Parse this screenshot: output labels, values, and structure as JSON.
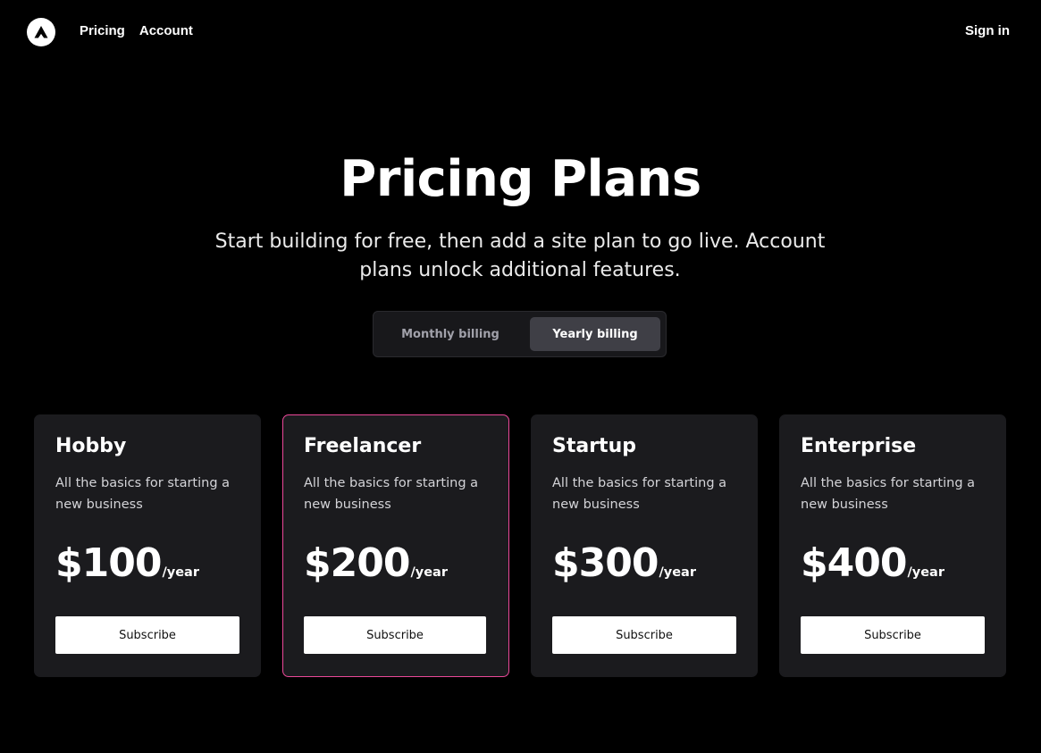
{
  "header": {
    "logo_icon": "triangle-logo-icon",
    "nav": [
      {
        "label": "Pricing"
      },
      {
        "label": "Account"
      }
    ],
    "sign_in_label": "Sign in"
  },
  "hero": {
    "title": "Pricing Plans",
    "subtitle": "Start building for free, then add a site plan to go live. Account plans unlock additional features."
  },
  "billing_toggle": {
    "monthly_label": "Monthly billing",
    "yearly_label": "Yearly billing",
    "selected": "Yearly billing"
  },
  "plans": [
    {
      "name": "Hobby",
      "description": "All the basics for starting a new business",
      "price": "$100",
      "period": "/year",
      "cta": "Subscribe"
    },
    {
      "name": "Freelancer",
      "description": "All the basics for starting a new business",
      "price": "$200",
      "period": "/year",
      "cta": "Subscribe",
      "highlight": true
    },
    {
      "name": "Startup",
      "description": "All the basics for starting a new business",
      "price": "$300",
      "period": "/year",
      "cta": "Subscribe"
    },
    {
      "name": "Enterprise",
      "description": "All the basics for starting a new business",
      "price": "$400",
      "period": "/year",
      "cta": "Subscribe"
    }
  ],
  "colors": {
    "background": "#000000",
    "card_background": "#1b1b1e",
    "highlight_border": "#ec4899",
    "toggle_active": "#3f3f46"
  }
}
